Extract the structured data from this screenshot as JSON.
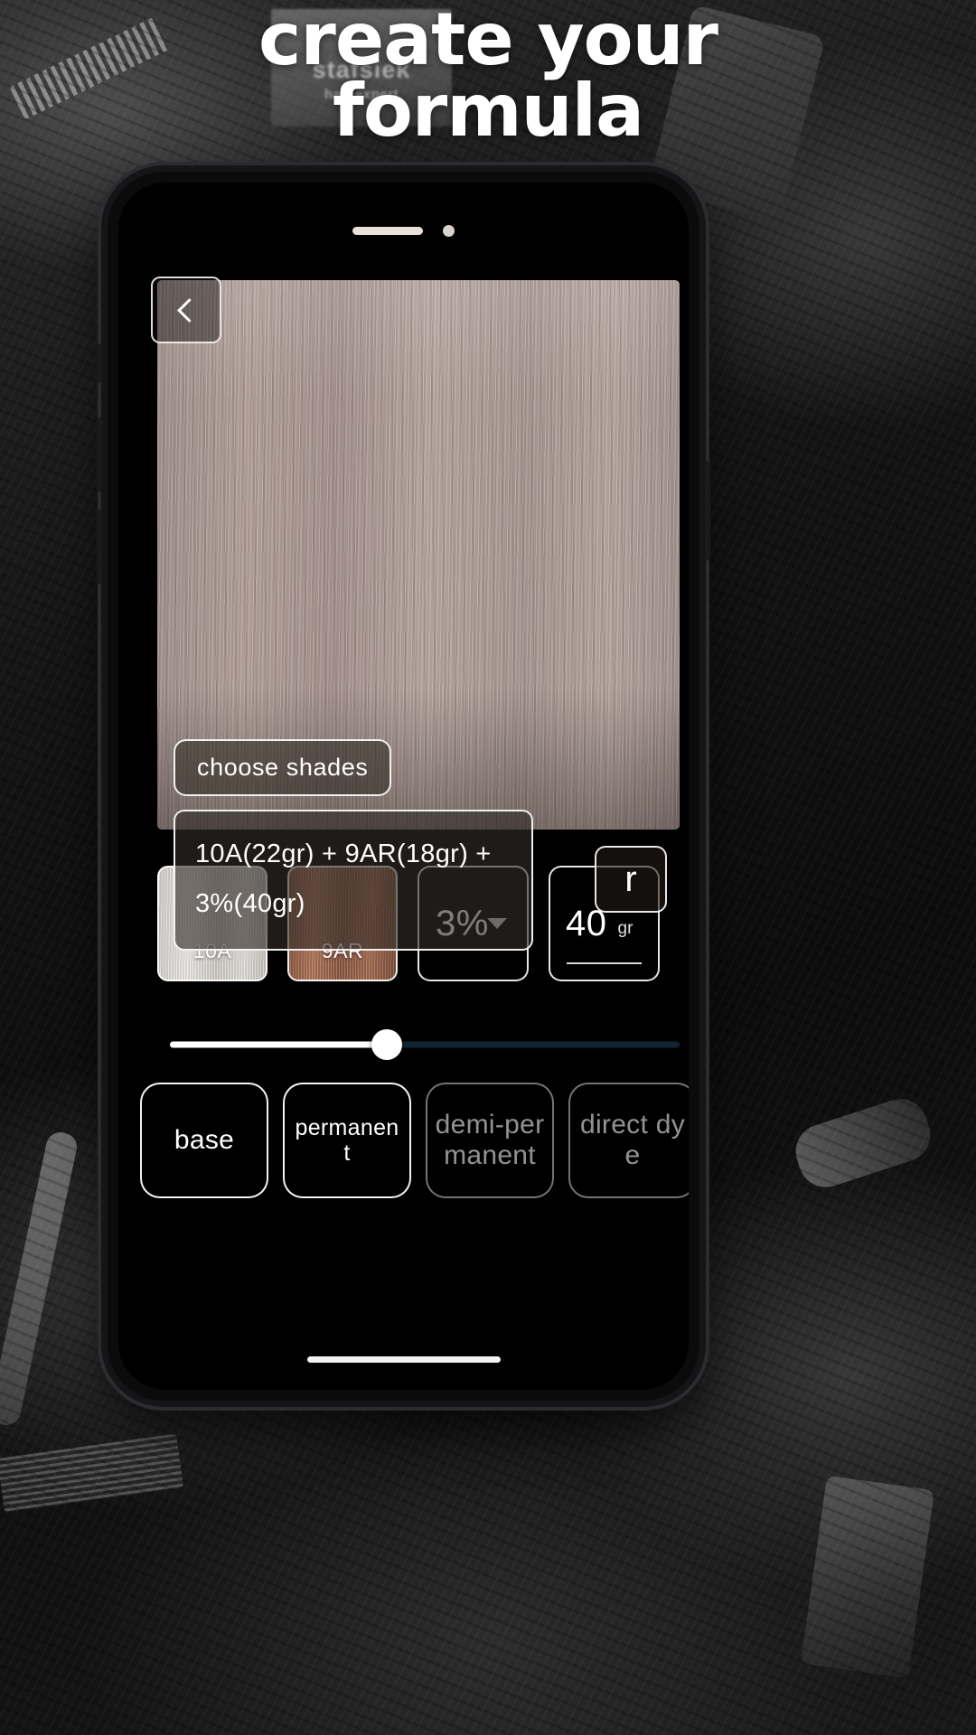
{
  "headline": {
    "line1": "create your",
    "line2": "formula"
  },
  "background_card": {
    "brand": "stafsiek",
    "tagline": "hair expert"
  },
  "colors": {
    "accent_white": "#ffffff",
    "screen_bg": "#000000",
    "slider_track": "#102433",
    "swatch_10a": "#d6d2ce",
    "swatch_9ar": "#9a6148"
  },
  "app": {
    "back_button": "back-arrow",
    "hero": {
      "choose_shades_label": "choose  shades",
      "formula_text": "10A(22gr) + 9AR(18gr) + 3%(40gr)",
      "reset_label": "r"
    },
    "selectors": {
      "shades": [
        {
          "code": "10A",
          "name": "shade-swatch-10a"
        },
        {
          "code": "9AR",
          "name": "shade-swatch-9ar"
        }
      ],
      "developer": {
        "value": "3%",
        "icon": "chevron-down-icon"
      },
      "amount": {
        "value": "40",
        "unit": "gr"
      }
    },
    "slider": {
      "value_percent": 44
    },
    "type_buttons": [
      {
        "label": "base",
        "active": true
      },
      {
        "label": "permanent",
        "active": true
      },
      {
        "label": "demi-permanent",
        "active": false
      },
      {
        "label": "direct dye",
        "active": false
      }
    ]
  }
}
